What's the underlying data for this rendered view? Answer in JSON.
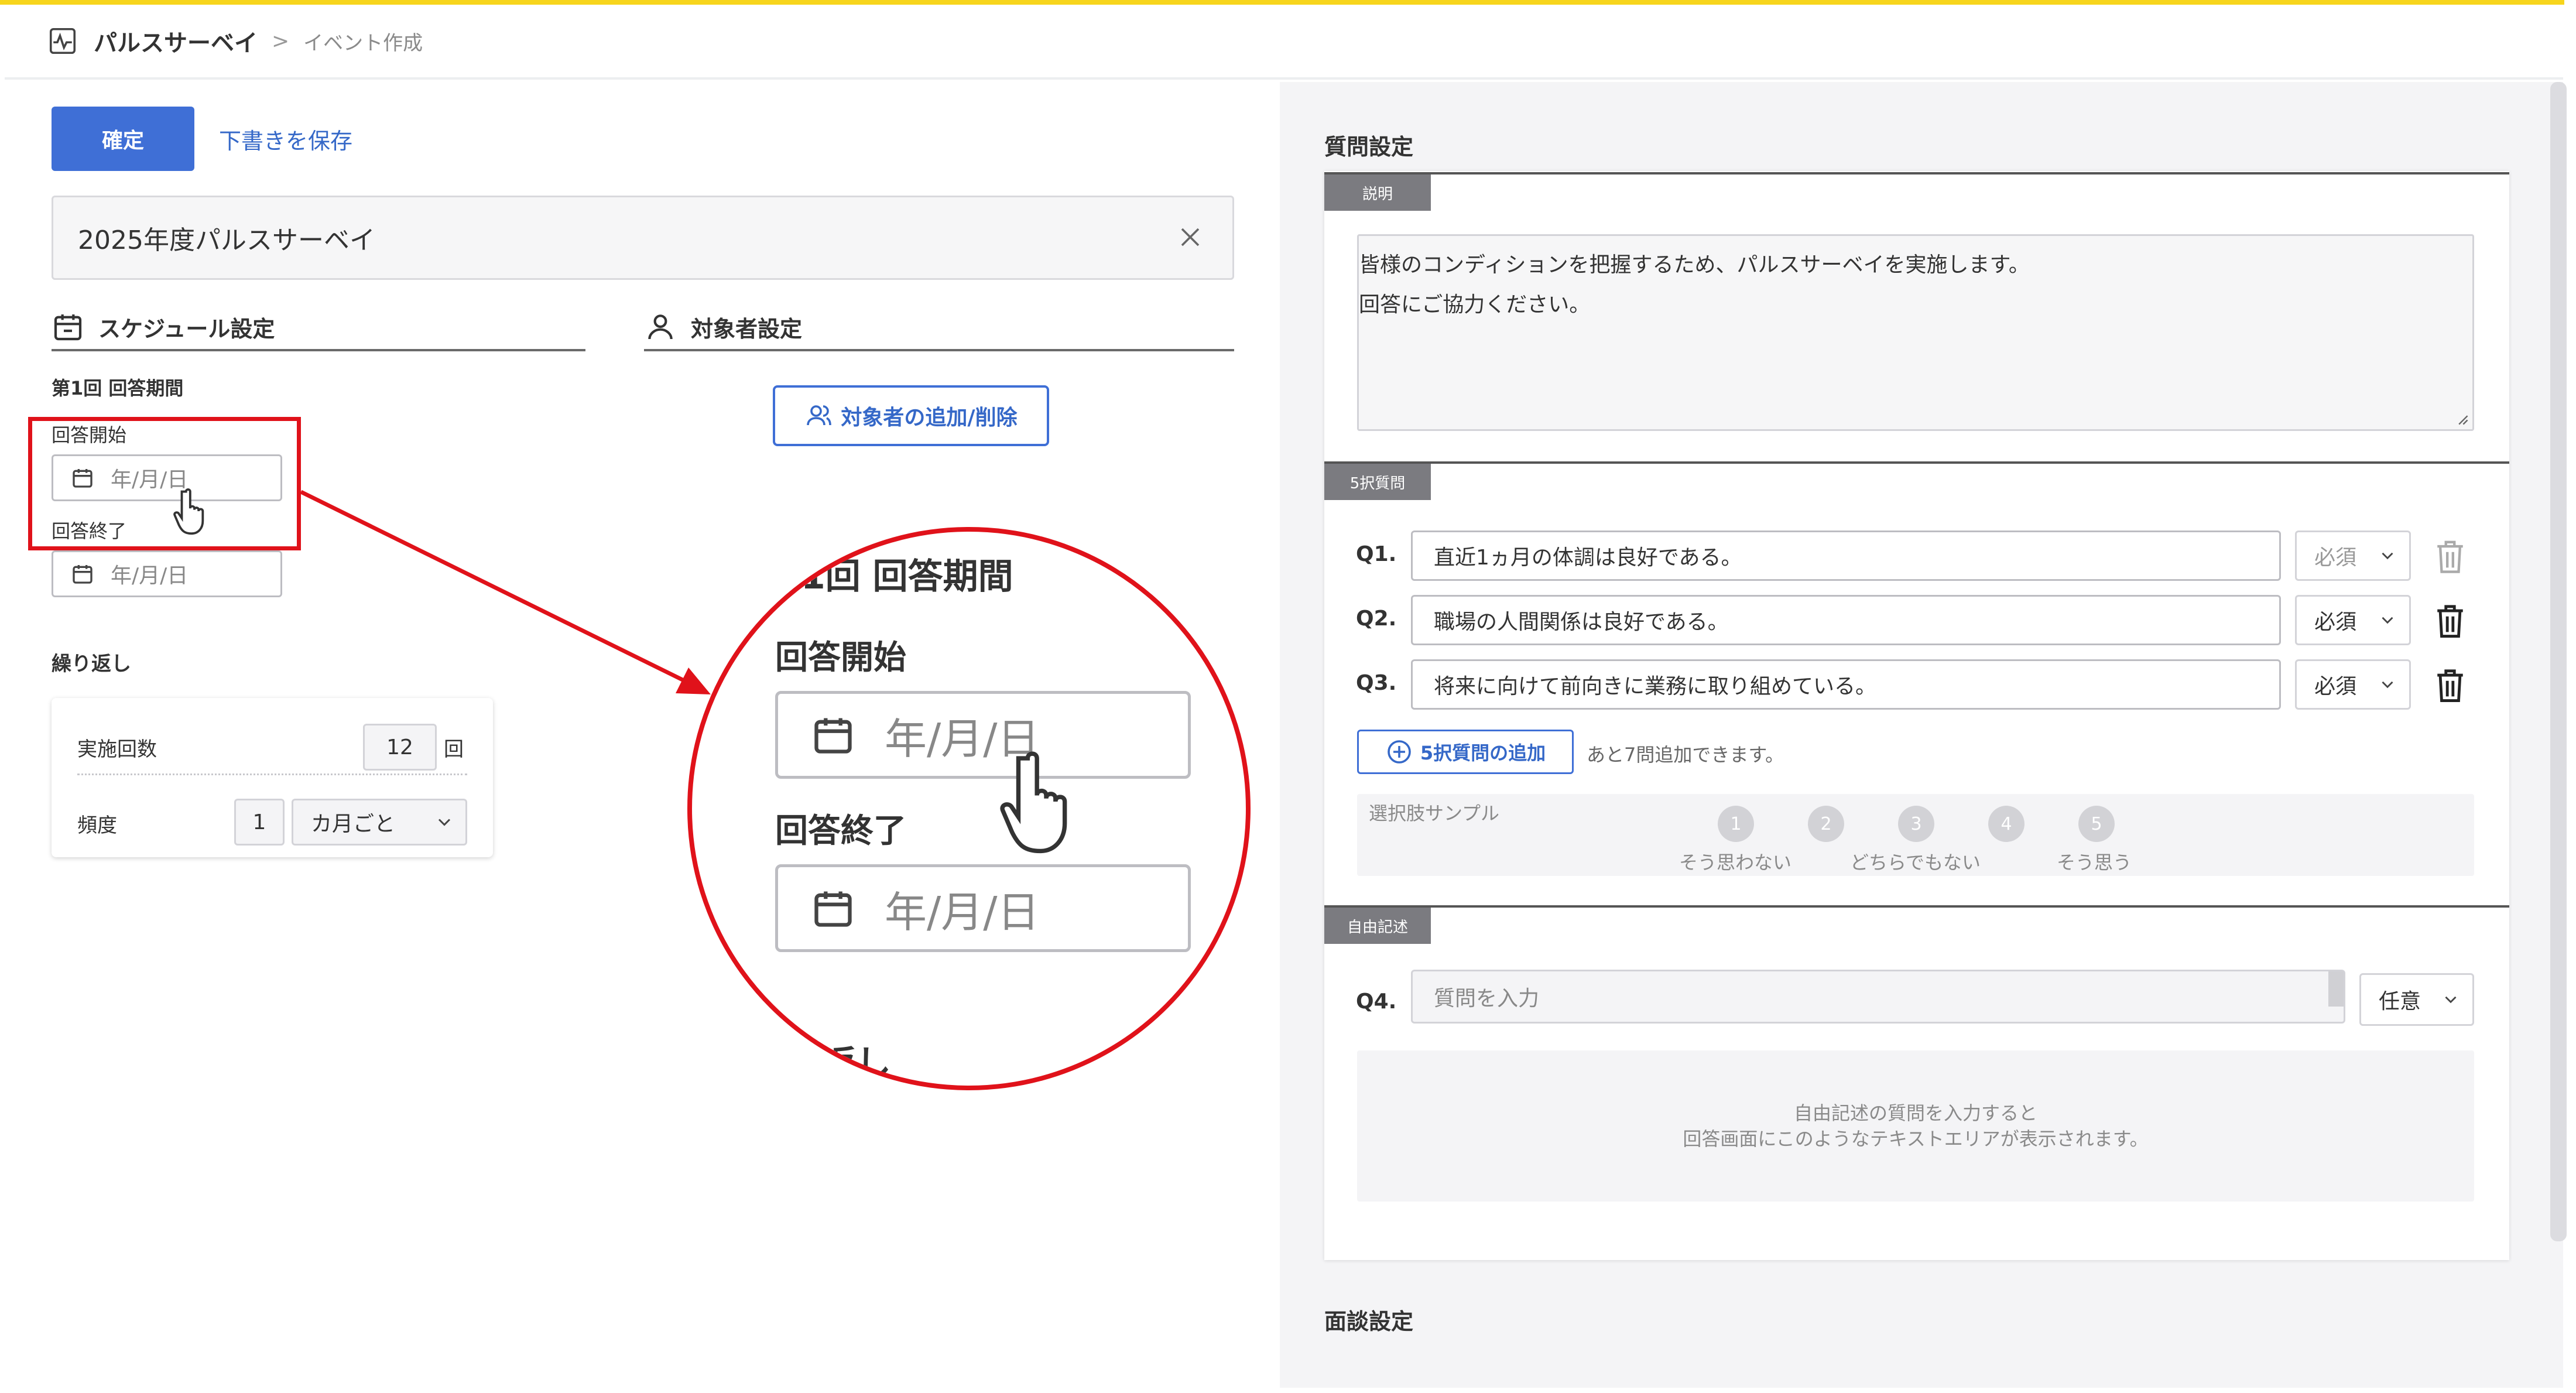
{
  "header": {
    "app_name": "パルスサーベイ",
    "breadcrumb_sep": ">",
    "crumb": "イベント作成"
  },
  "actions": {
    "confirm": "確定",
    "save_draft": "下書きを保存"
  },
  "survey_title": "2025年度パルスサーベイ",
  "schedule": {
    "heading": "スケジュール設定",
    "period_label": "第1回 回答期間",
    "start_label": "回答開始",
    "end_label": "回答終了",
    "date_placeholder": "年/月/日",
    "repeat_heading": "繰り返し",
    "count_label": "実施回数",
    "count_value": "12",
    "count_unit": "回",
    "freq_label": "頻度",
    "freq_value": "1",
    "freq_unit": "カ月ごと"
  },
  "target": {
    "heading": "対象者設定",
    "add_button": "対象者の追加/削除"
  },
  "zoom": {
    "period_label_partial": "1回 回答期間",
    "start_label": "回答開始",
    "end_label": "回答終了",
    "date_placeholder": "年/月/日",
    "repeat_partial": "返し"
  },
  "questions": {
    "heading": "質問設定",
    "desc_tag": "説明",
    "description_lines": [
      "皆様のコンディションを把握するため、パルスサーベイを実施します。",
      "回答にご協力ください。"
    ],
    "choice_tag": "5択質問",
    "items": [
      {
        "label": "Q1.",
        "text": "直近1ヵ月の体調は良好である。",
        "req": "必須"
      },
      {
        "label": "Q2.",
        "text": "職場の人間関係は良好である。",
        "req": "必須"
      },
      {
        "label": "Q3.",
        "text": "将来に向けて前向きに業務に取り組めている。",
        "req": "必須"
      }
    ],
    "add_choice_button": "5択質問の追加",
    "remaining": "あと7問追加できます。",
    "sample_title": "選択肢サンプル",
    "scale": [
      "1",
      "2",
      "3",
      "4",
      "5"
    ],
    "scale_labels": [
      "そう思わない",
      "どちらでもない",
      "そう思う"
    ],
    "free_tag": "自由記述",
    "free_label": "Q4.",
    "free_placeholder": "質問を入力",
    "free_req": "任意",
    "free_info_lines": [
      "自由記述の質問を入力すると",
      "回答画面にこのようなテキストエリアが表示されます。"
    ]
  },
  "meeting": {
    "heading": "面談設定"
  },
  "colors": {
    "accent": "#3f6fd6",
    "annotation": "#e0121a",
    "topline": "#f7d51d"
  }
}
